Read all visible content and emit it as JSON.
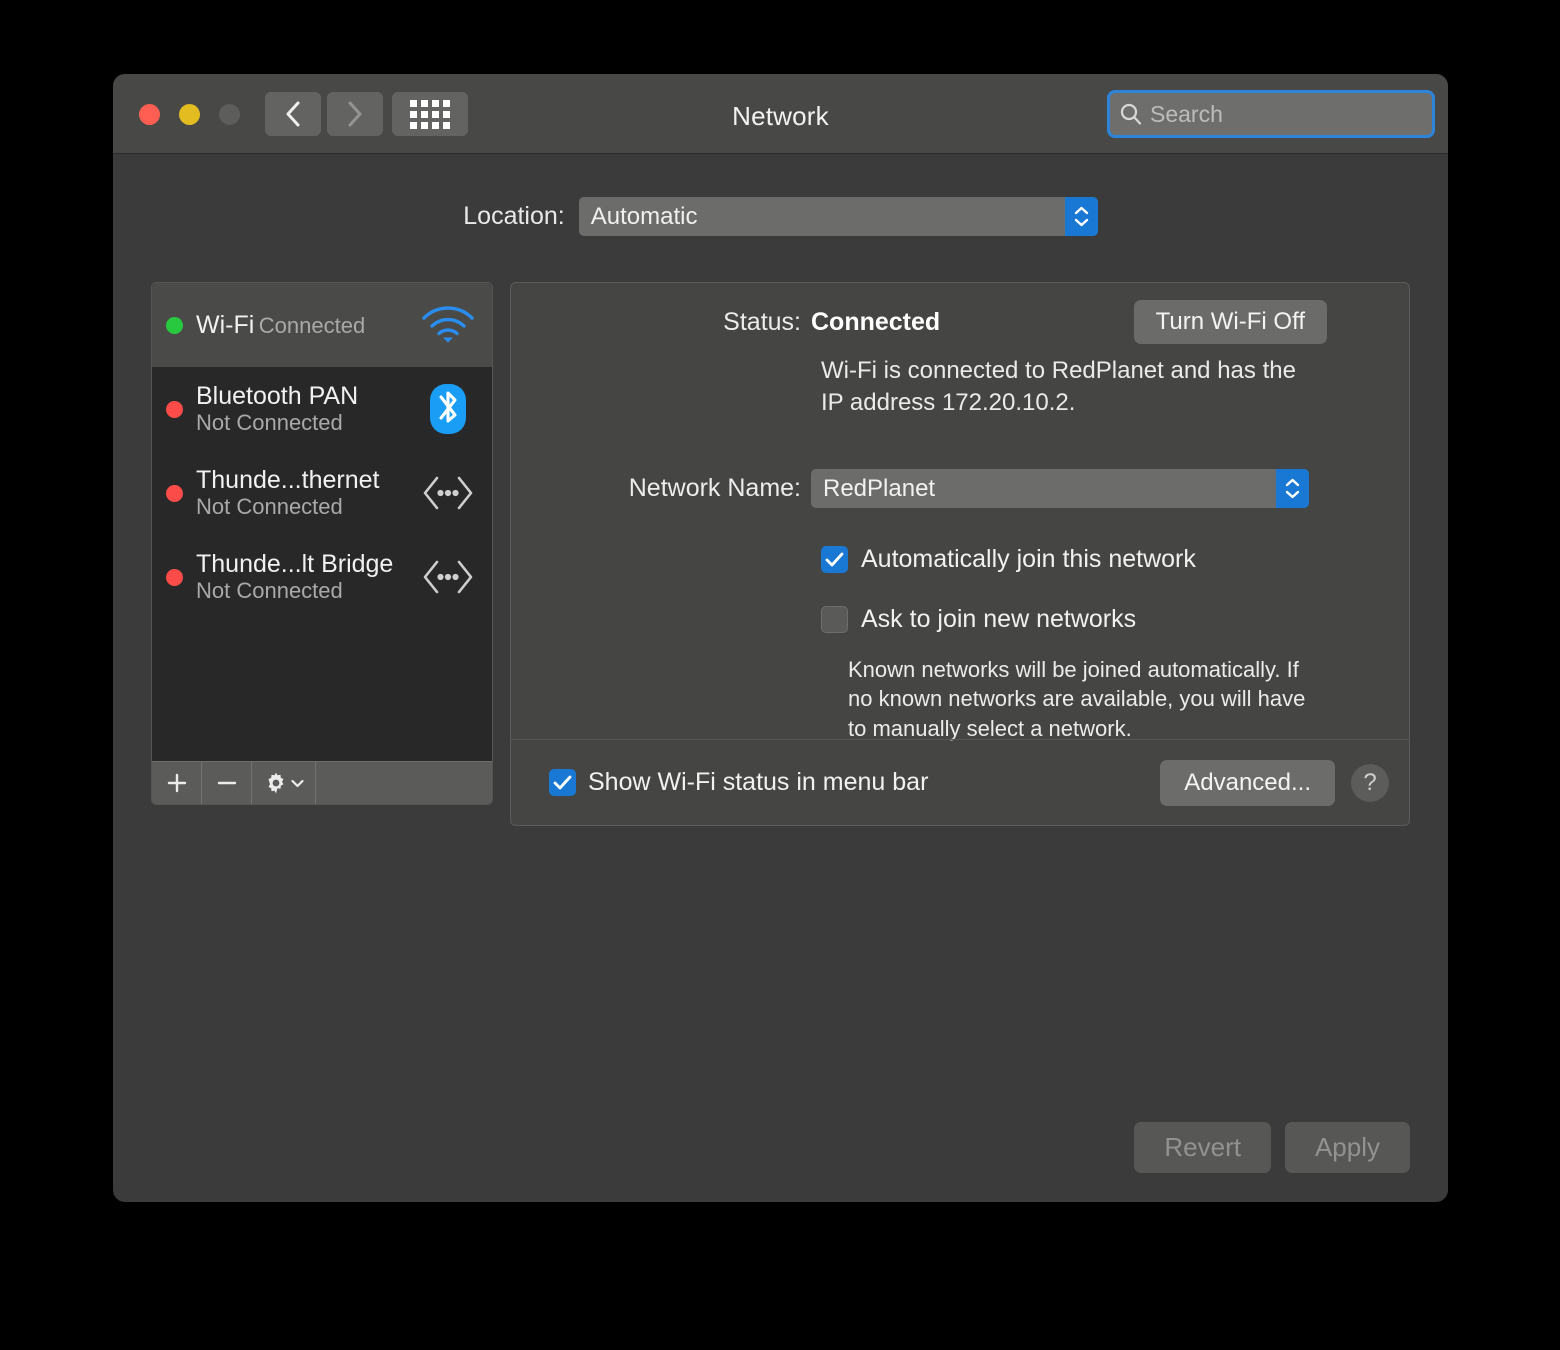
{
  "window": {
    "title": "Network",
    "traffic_lights": [
      "close",
      "minimize",
      "zoom"
    ]
  },
  "toolbar": {
    "back_icon": "chevron-left-icon",
    "forward_icon": "chevron-right-icon",
    "showall_icon": "grid-icon",
    "search_placeholder": "Search",
    "search_value": "",
    "search_icon": "search-icon"
  },
  "location": {
    "label": "Location:",
    "value": "Automatic",
    "options": [
      "Automatic"
    ]
  },
  "sidebar": {
    "services": [
      {
        "name": "Wi-Fi",
        "status": "Connected",
        "dot": "green",
        "icon": "wifi-icon",
        "selected": true
      },
      {
        "name": "Bluetooth PAN",
        "status": "Not Connected",
        "dot": "red",
        "icon": "bluetooth-icon",
        "selected": false
      },
      {
        "name": "Thunde...thernet",
        "status": "Not Connected",
        "dot": "red",
        "icon": "thunderbolt-icon",
        "selected": false
      },
      {
        "name": "Thunde...lt Bridge",
        "status": "Not Connected",
        "dot": "red",
        "icon": "thunderbolt-icon",
        "selected": false
      }
    ],
    "toolbar": {
      "add": "+",
      "remove": "–",
      "gear_icon": "gear-icon",
      "gear_chevron": "chevron-down-icon"
    }
  },
  "panel": {
    "status_label": "Status:",
    "status_value": "Connected",
    "turn_off_button": "Turn Wi-Fi Off",
    "status_description": "Wi-Fi is connected to RedPlanet and has the IP address 172.20.10.2.",
    "network_name_label": "Network Name:",
    "network_name_value": "RedPlanet",
    "auto_join": {
      "label": "Automatically join this network",
      "checked": true
    },
    "ask_join": {
      "label": "Ask to join new networks",
      "checked": false
    },
    "hint": "Known networks will be joined automatically. If no known networks are available, you will have to manually select a network.",
    "menu_bar_check": {
      "label": "Show Wi-Fi status in menu bar",
      "checked": true
    },
    "advanced_button": "Advanced...",
    "help_button": "?"
  },
  "footer": {
    "revert_button": "Revert",
    "apply_button": "Apply"
  },
  "colors": {
    "accent": "#1878d4",
    "connected_dot": "#28c93f",
    "disconnected_dot": "#fc4c4a",
    "window_bg": "#3b3b3b",
    "titlebar_bg": "#484846"
  }
}
